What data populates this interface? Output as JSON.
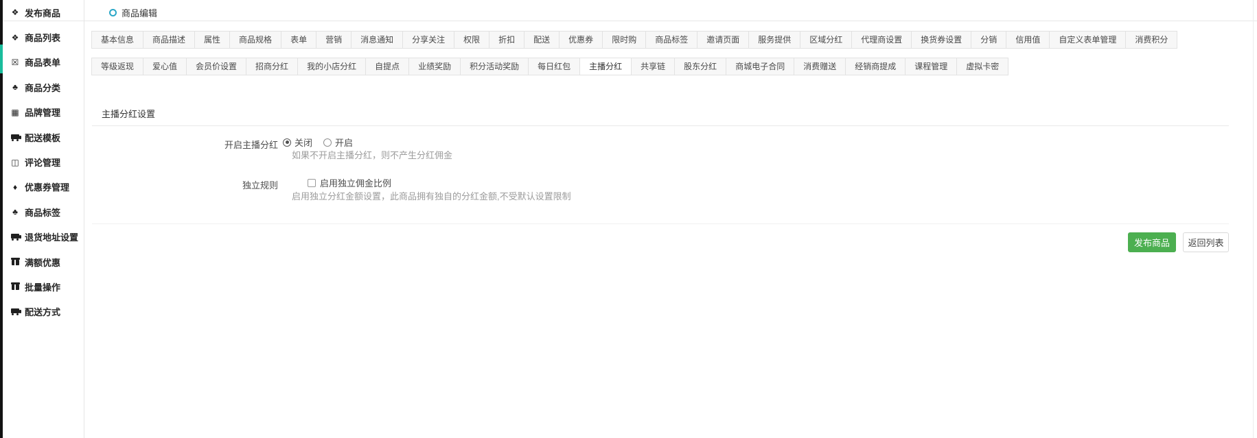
{
  "colors": {
    "rail": "#121212",
    "rail_accent": "#1abc9c",
    "title_icon": "#2aa7c7",
    "publish_button": "#4caf50",
    "tab_bg": "#f7f7f7",
    "help_text": "#9c9c9c"
  },
  "sidebar": {
    "items": [
      {
        "name": "publish-product",
        "icon": "cubes",
        "label": "发布商品"
      },
      {
        "name": "product-list",
        "icon": "cubes",
        "label": "商品列表"
      },
      {
        "name": "product-form",
        "icon": "file-excel",
        "label": "商品表单"
      },
      {
        "name": "product-category",
        "icon": "sitemap",
        "label": "商品分类"
      },
      {
        "name": "brand-management",
        "icon": "briefcase",
        "label": "品牌管理"
      },
      {
        "name": "shipping-template",
        "icon": "truck",
        "label": "配送模板"
      },
      {
        "name": "review-management",
        "icon": "columns",
        "label": "评论管理"
      },
      {
        "name": "coupon-management",
        "icon": "tags",
        "label": "优惠券管理"
      },
      {
        "name": "product-tags",
        "icon": "sitemap",
        "label": "商品标签"
      },
      {
        "name": "return-address",
        "icon": "truck",
        "label": "退货地址设置"
      },
      {
        "name": "full-discount",
        "icon": "gift",
        "label": "满额优惠"
      },
      {
        "name": "batch-operation",
        "icon": "gift",
        "label": "批量操作"
      },
      {
        "name": "shipping-method",
        "icon": "truck",
        "label": "配送方式"
      }
    ]
  },
  "header": {
    "title": "商品编辑"
  },
  "tabs": {
    "active": "主播分红",
    "items": [
      "基本信息",
      "商品描述",
      "属性",
      "商品规格",
      "表单",
      "营销",
      "消息通知",
      "分享关注",
      "权限",
      "折扣",
      "配送",
      "优惠券",
      "限时购",
      "商品标签",
      "邀请页面",
      "服务提供",
      "区域分红",
      "代理商设置",
      "换货券设置",
      "分销",
      "信用值",
      "自定义表单管理",
      "消费积分",
      "等级返现",
      "爱心值",
      "会员价设置",
      "招商分红",
      "我的小店分红",
      "自提点",
      "业绩奖励",
      "积分活动奖励",
      "每日红包",
      "主播分红",
      "共享链",
      "股东分红",
      "商城电子合同",
      "消费赠送",
      "经销商提成",
      "课程管理",
      "虚拟卡密"
    ]
  },
  "section": {
    "title": "主播分红设置"
  },
  "form": {
    "anchor_dividend": {
      "label": "开启主播分红",
      "options": [
        {
          "label": "关闭",
          "checked": true
        },
        {
          "label": "开启",
          "checked": false
        }
      ],
      "help": "如果不开启主播分红，则不产生分红佣金"
    },
    "independent_rule": {
      "label": "独立规则",
      "checkbox_label": "启用独立佣金比例",
      "checked": false,
      "help": "启用独立分红金额设置，此商品拥有独自的分红金额,不受默认设置限制"
    }
  },
  "footer": {
    "publish_label": "发布商品",
    "back_label": "返回列表"
  }
}
